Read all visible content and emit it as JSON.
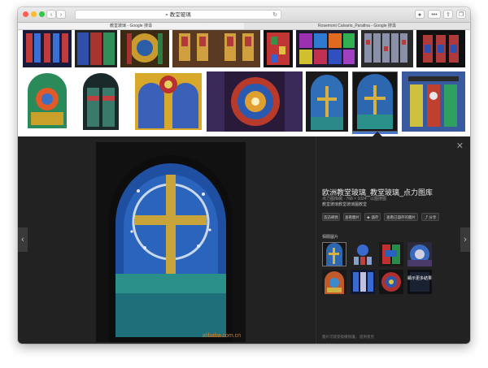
{
  "window": {
    "traffic_lights": [
      "#fc5f57",
      "#fdbc2e",
      "#33c748"
    ],
    "address_text": "教堂玻璃",
    "search_icon": "search-icon",
    "reload_icon": "reload-icon"
  },
  "tabs": [
    {
      "label": "教堂玻璃 - Google 搜尋"
    },
    {
      "label": "Rosemont Calvario_Parafina - Google 搜尋"
    }
  ],
  "viewer": {
    "title": "欧洲教堂玻璃_教堂玻璃_点力图库",
    "meta": "点力图库網 · 768 × 1024 · 以图搜图",
    "description": "教堂玻璃教堂玻璃圖教堂",
    "buttons": [
      "造訪網頁",
      "查看圖片",
      "儲存",
      "查看已儲存的圖片",
      "分享"
    ],
    "related_label": "相關圖片",
    "more_overlay": "顯示更多結果",
    "footer_left": "圖片可能受版權保護。",
    "footer_right": "提供意見",
    "watermark": "alibaba.com.cn"
  }
}
